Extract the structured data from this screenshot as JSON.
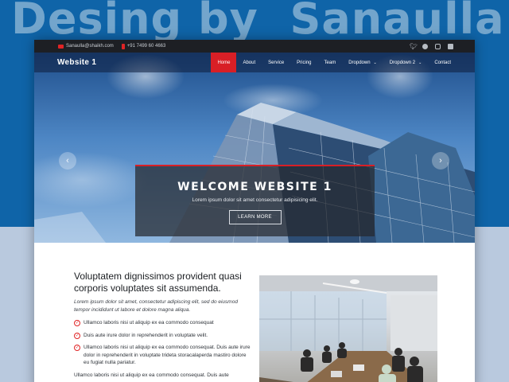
{
  "poster": {
    "title": "Desing by  Sanaulla"
  },
  "topbar": {
    "email": "Sanaulla@shaikh.com",
    "phone": "+91 7499 60 4663",
    "social_icons": [
      "twitter-icon",
      "facebook-icon",
      "instagram-icon",
      "linkedin-icon"
    ]
  },
  "navbar": {
    "brand": "Website 1",
    "menu": [
      {
        "label": "Home",
        "active": true
      },
      {
        "label": "About"
      },
      {
        "label": "Service"
      },
      {
        "label": "Pricing"
      },
      {
        "label": "Team"
      },
      {
        "label": "Dropdown",
        "caret": "⌄"
      },
      {
        "label": "Dropdown 2",
        "caret": "⌄"
      },
      {
        "label": "Contact"
      }
    ]
  },
  "hero": {
    "title": "WELCOME WEBSITE 1",
    "subtitle": "Lorem ipsum dolor sit amet consectetur adipisicing elit.",
    "button": "LEARN MORE",
    "prev_icon": "‹",
    "next_icon": "›",
    "slides": 3,
    "active_slide": 1
  },
  "about": {
    "heading": "Voluptatem dignissimos provident quasi corporis voluptates sit assumenda.",
    "lead": "Lorem ipsum dolor sit amet, consectetur adipiscing elit, sed do eiusmod tempor incididunt ut labore et dolore magna aliqua.",
    "items": [
      "Ullamco laboris nisi ut aliquip ex ea commodo consequat",
      "Duis aute irure dolor in reprehenderit in voluptate velit.",
      "Ullamco laboris nisi ut aliquip ex ea commodo consequat. Duis aute irure dolor in reprehenderit in voluptate trideta storacalaperda mastiro dolore eu fugiat nulla pariatur."
    ],
    "extra": "Ullamco laboris nisi ut aliquip ex ea commodo consequat. Duis aute"
  },
  "colors": {
    "accent": "#d81f26",
    "topbar": "#1d1f24",
    "poster_blue": "#0f64a8"
  }
}
